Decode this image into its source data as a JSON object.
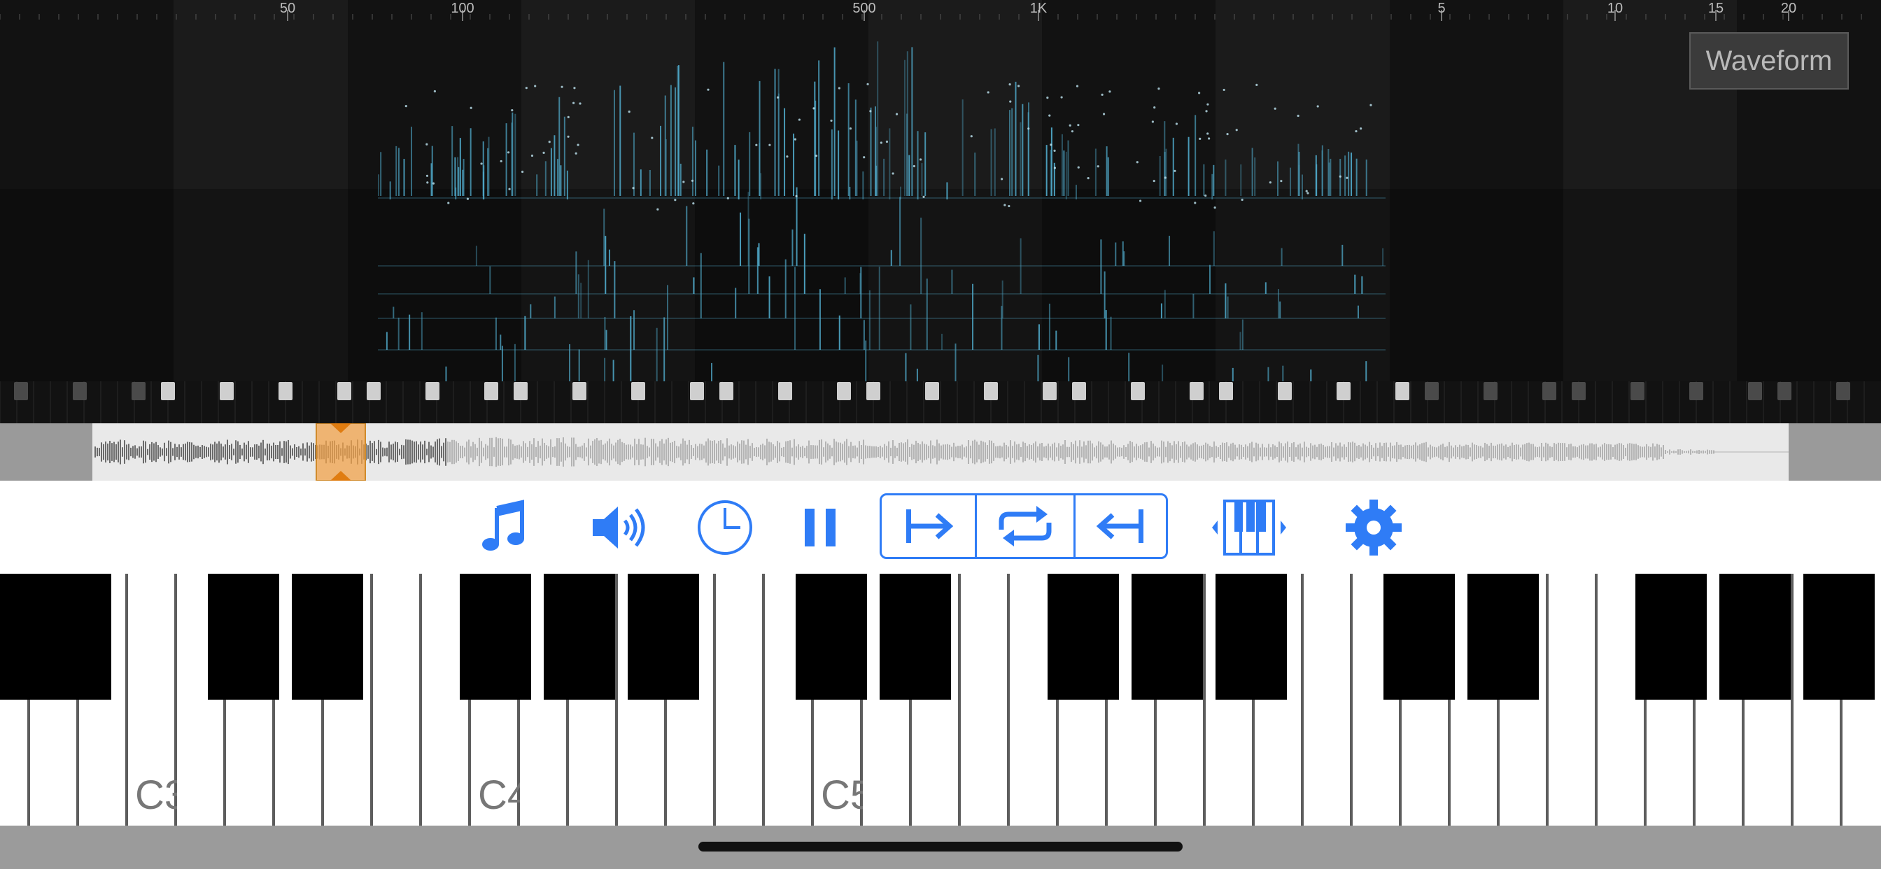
{
  "spectrum": {
    "frequency_ticks": [
      "50",
      "100",
      "500",
      "1K",
      "5",
      "10",
      "15",
      "20"
    ],
    "accent_color": "#4fa8c8"
  },
  "view_toggle": {
    "label": "Waveform"
  },
  "overview": {
    "playhead_color": "#f0a24a"
  },
  "toolbar": {
    "accent_color": "#2f7cf6",
    "buttons": [
      {
        "name": "music-note-icon"
      },
      {
        "name": "speaker-icon"
      },
      {
        "name": "clock-icon"
      },
      {
        "name": "pause-icon"
      },
      {
        "name": "loop-start-icon"
      },
      {
        "name": "repeat-icon"
      },
      {
        "name": "loop-end-icon"
      },
      {
        "name": "piano-range-icon"
      },
      {
        "name": "gear-icon"
      }
    ]
  },
  "keyboard": {
    "octave_labels": [
      "C3",
      "C4",
      "C5"
    ]
  }
}
